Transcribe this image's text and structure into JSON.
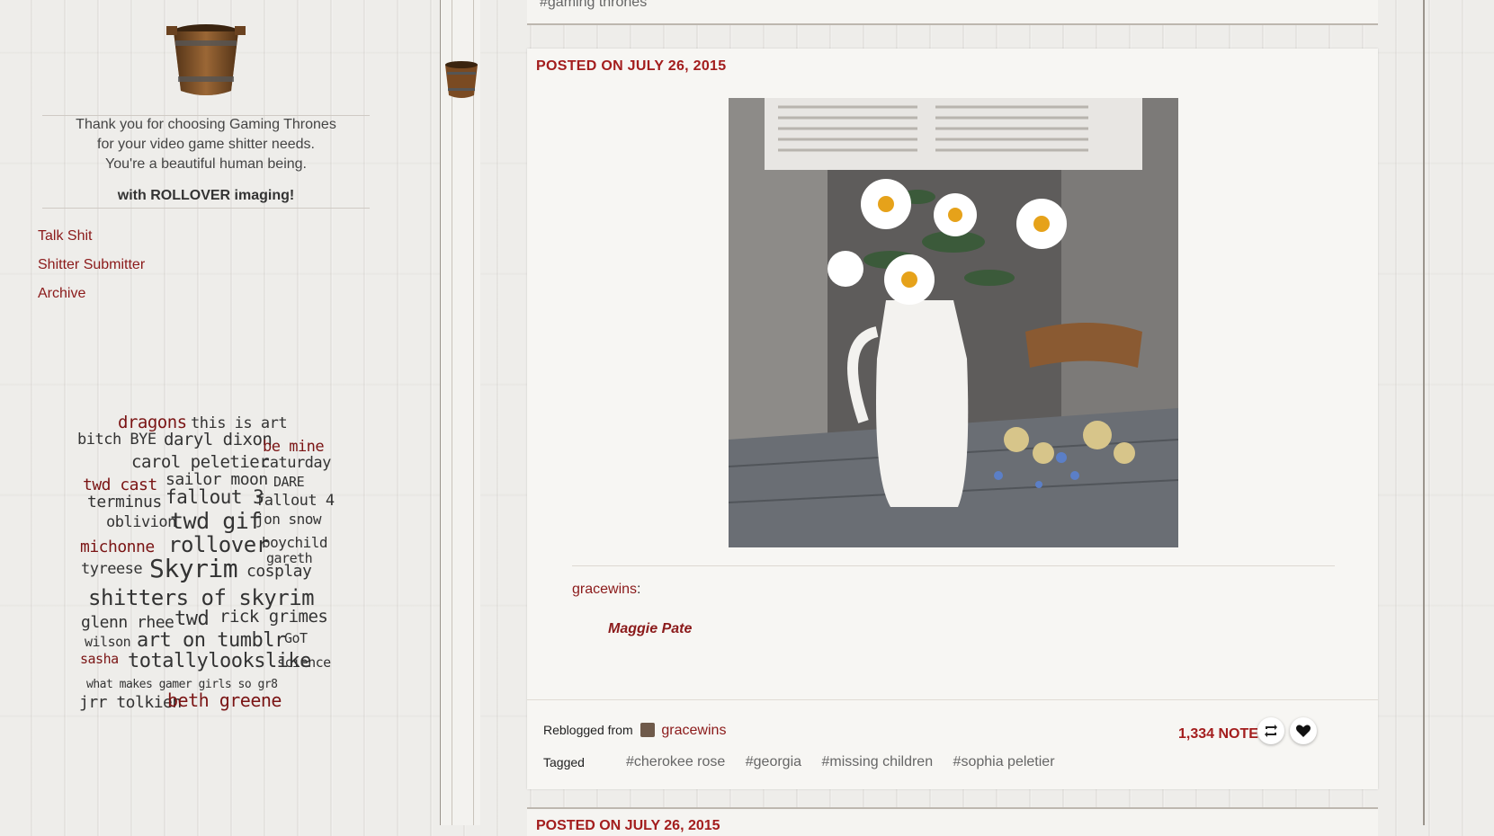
{
  "sidebar": {
    "description_lines": [
      "Thank you for choosing Gaming Thrones",
      "for your video game shitter needs.",
      "You're a beautiful human being."
    ],
    "rollover": "with ROLLOVER imaging!",
    "links": [
      "Talk Shit",
      "Shitter Submitter",
      "Archive"
    ],
    "tags": [
      "dragons",
      "this is art",
      "bitch BYE",
      "daryl dixon",
      "be mine",
      "carol peletier",
      "caturday",
      "twd cast",
      "sailor moon",
      "DARE",
      "terminus",
      "fallout 3",
      "fallout 4",
      "oblivion",
      "twd gif",
      "jon snow",
      "michonne",
      "rollover",
      "boychild",
      "gareth",
      "tyreese",
      "Skyrim",
      "cosplay",
      "shitters of skyrim",
      "glenn rhee",
      "twd",
      "rick grimes",
      "wilson",
      "art on tumblr",
      "GoT",
      "sasha",
      "totallylookslike",
      "science",
      "what makes gamer girls so gr8",
      "jrr tolkien",
      "beth greene"
    ]
  },
  "prev_post": {
    "tag": "#gaming thrones"
  },
  "post": {
    "posted": "POSTED ON JULY 26, 2015",
    "source_user": "gracewins",
    "source_colon": ":",
    "quote_name": "Maggie Pate",
    "reblogged_label": "Reblogged from",
    "reblogged_user": "gracewins",
    "notes": "1,334 NOTES",
    "tagged_label": "Tagged",
    "tags": [
      "#cherokee rose",
      "#georgia",
      "#missing children",
      "#sophia peletier"
    ]
  },
  "next_post": {
    "posted": "POSTED ON JULY 26, 2015"
  },
  "colors": {
    "accent": "#a31d1d",
    "link": "#8b1a1a"
  },
  "icons": {
    "reblog": "reblog-icon",
    "like": "heart-icon"
  }
}
